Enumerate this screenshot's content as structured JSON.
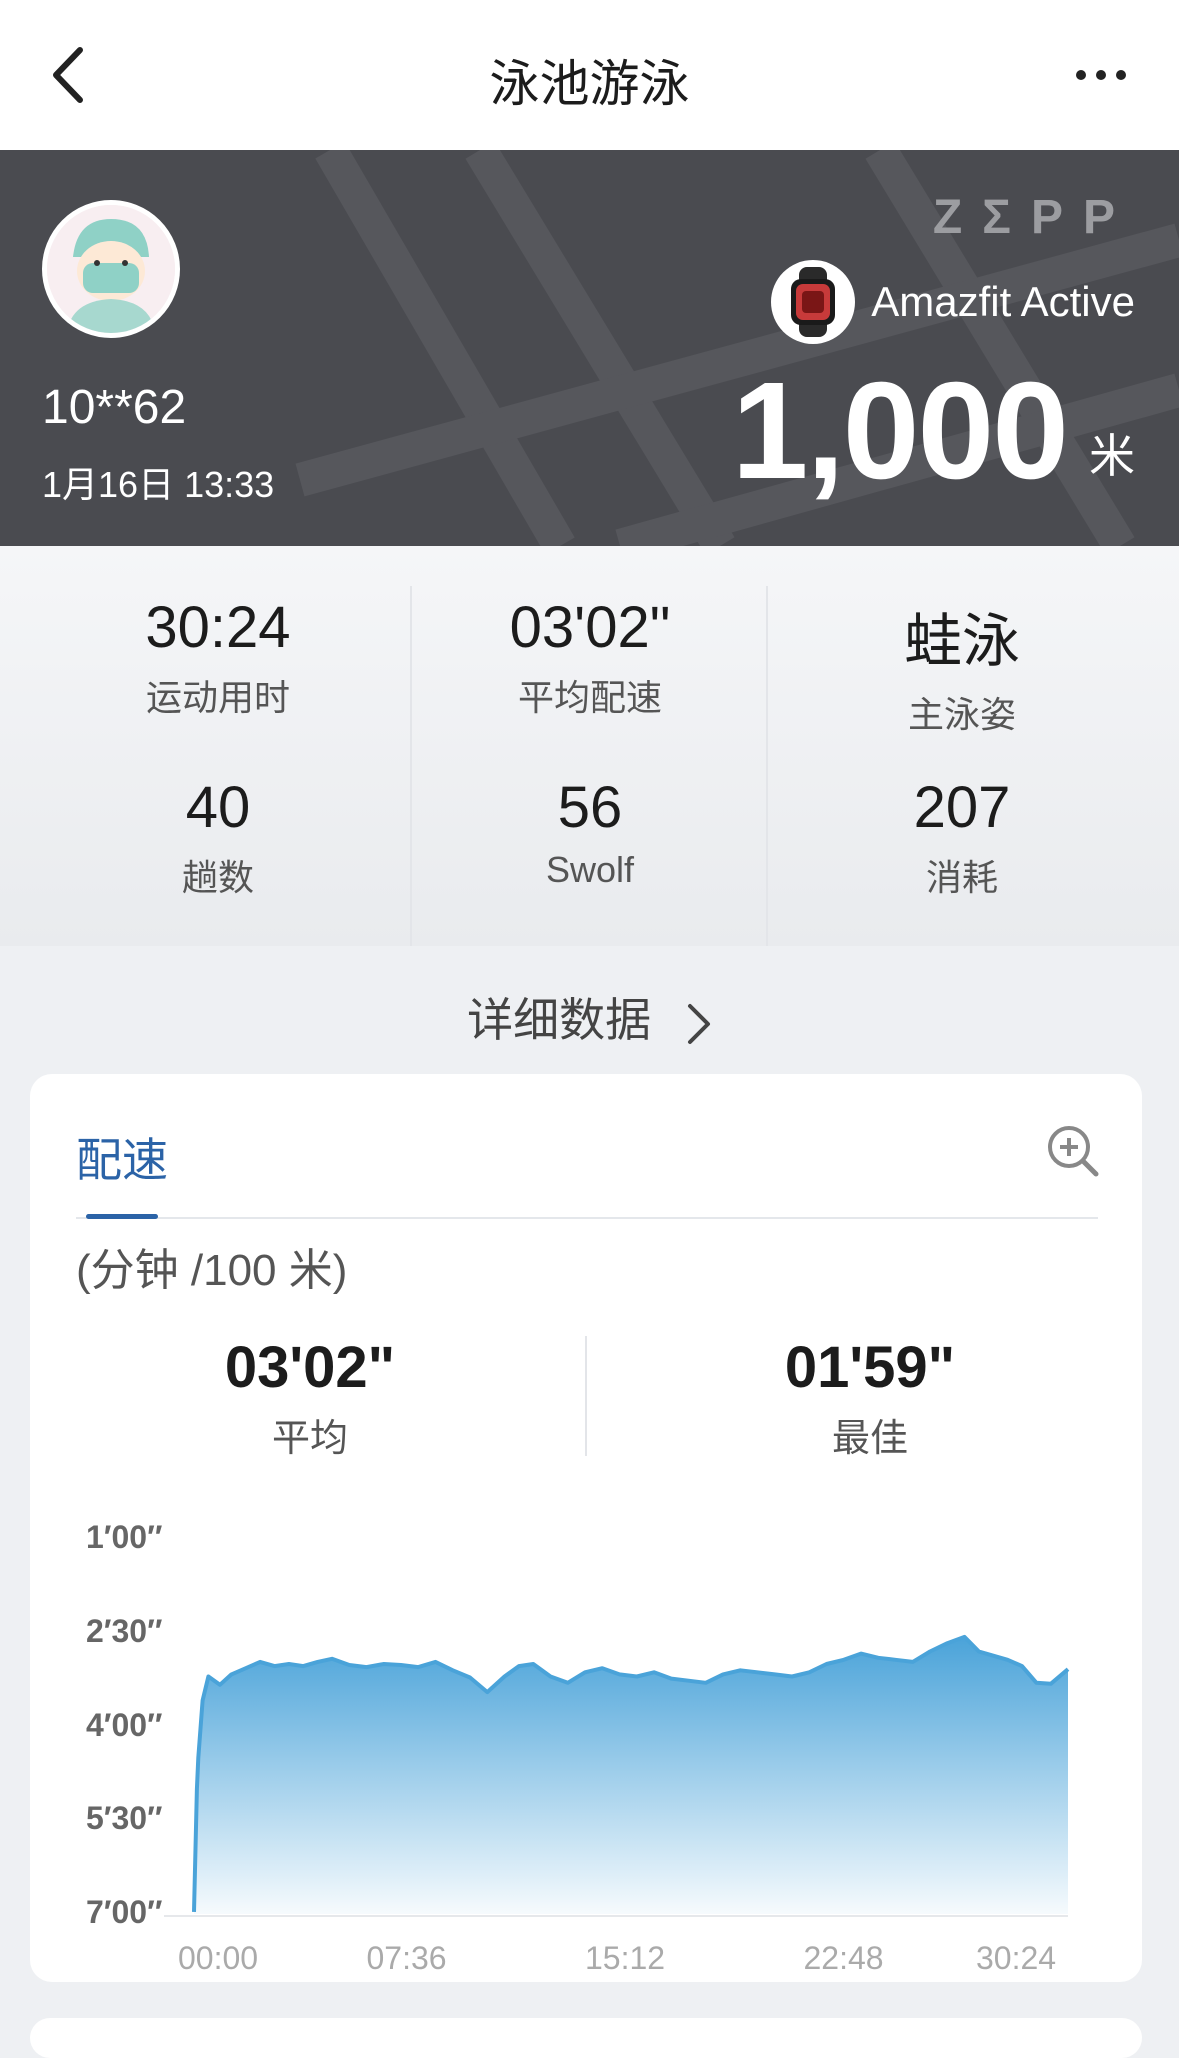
{
  "header": {
    "title": "泳池游泳",
    "back_icon": "chevron-left-icon",
    "more_icon": "more-dots-icon"
  },
  "hero": {
    "username": "10**62",
    "datetime": "1月16日 13:33",
    "brand": "ZΣPP",
    "device_name": "Amazfit Active",
    "distance": "1,000",
    "distance_unit": "米",
    "bg_color": "#4a4b50"
  },
  "stats": {
    "items": [
      {
        "value": "30:24",
        "label": "运动用时"
      },
      {
        "value": "03'02\"",
        "label": "平均配速"
      },
      {
        "value": "蛙泳",
        "label": "主泳姿"
      },
      {
        "value": "40",
        "label": "趟数"
      },
      {
        "value": "56",
        "label": "Swolf"
      },
      {
        "value": "207",
        "label": "消耗"
      }
    ]
  },
  "detail_link": {
    "label": "详细数据"
  },
  "pace_card": {
    "tab_label": "配速",
    "accent": "#2b63a7",
    "unit": "(分钟 /100 米)",
    "avg_value": "03'02\"",
    "avg_label": "平均",
    "best_value": "01'59\"",
    "best_label": "最佳"
  },
  "chart_data": {
    "type": "area",
    "y_tick_labels": [
      "1′00″",
      "2′30″",
      "4′00″",
      "5′30″",
      "7′00″"
    ],
    "x_tick_labels": [
      "00:00",
      "07:36",
      "15:12",
      "22:48",
      "30:24"
    ],
    "x_range_minutes": [
      0,
      30.4
    ],
    "y_range_seconds_per_100m": [
      60,
      420
    ],
    "y_axis_inverted": true,
    "fill_color": "#4aa3d9",
    "series": [
      {
        "x": [
          0,
          0.1,
          0.15,
          0.3,
          0.5,
          0.9,
          1.3,
          1.8,
          2.3,
          2.8,
          3.3,
          3.8,
          4.3,
          4.8,
          5.4,
          6.0,
          6.6,
          7.2,
          7.8,
          8.4,
          9.0,
          9.6,
          10.2,
          10.8,
          11.3,
          11.8,
          12.4,
          13.0,
          13.6,
          14.2,
          14.8,
          15.4,
          16.0,
          16.6,
          17.2,
          17.8,
          18.4,
          19.0,
          19.6,
          20.2,
          20.8,
          21.4,
          22.0,
          22.6,
          23.2,
          23.8,
          24.4,
          25.0,
          25.6,
          26.2,
          26.8,
          27.3,
          27.8,
          28.3,
          28.8,
          29.3,
          29.8,
          30.4
        ],
        "y": [
          418,
          300,
          270,
          215,
          192,
          200,
          190,
          184,
          178,
          182,
          180,
          182,
          178,
          175,
          181,
          183,
          180,
          181,
          183,
          178,
          186,
          193,
          207,
          192,
          182,
          180,
          192,
          198,
          188,
          184,
          190,
          192,
          188,
          194,
          196,
          198,
          190,
          186,
          188,
          190,
          192,
          188,
          180,
          176,
          170,
          174,
          176,
          178,
          168,
          160,
          154,
          168,
          172,
          176,
          182,
          198,
          199,
          185
        ]
      }
    ]
  }
}
